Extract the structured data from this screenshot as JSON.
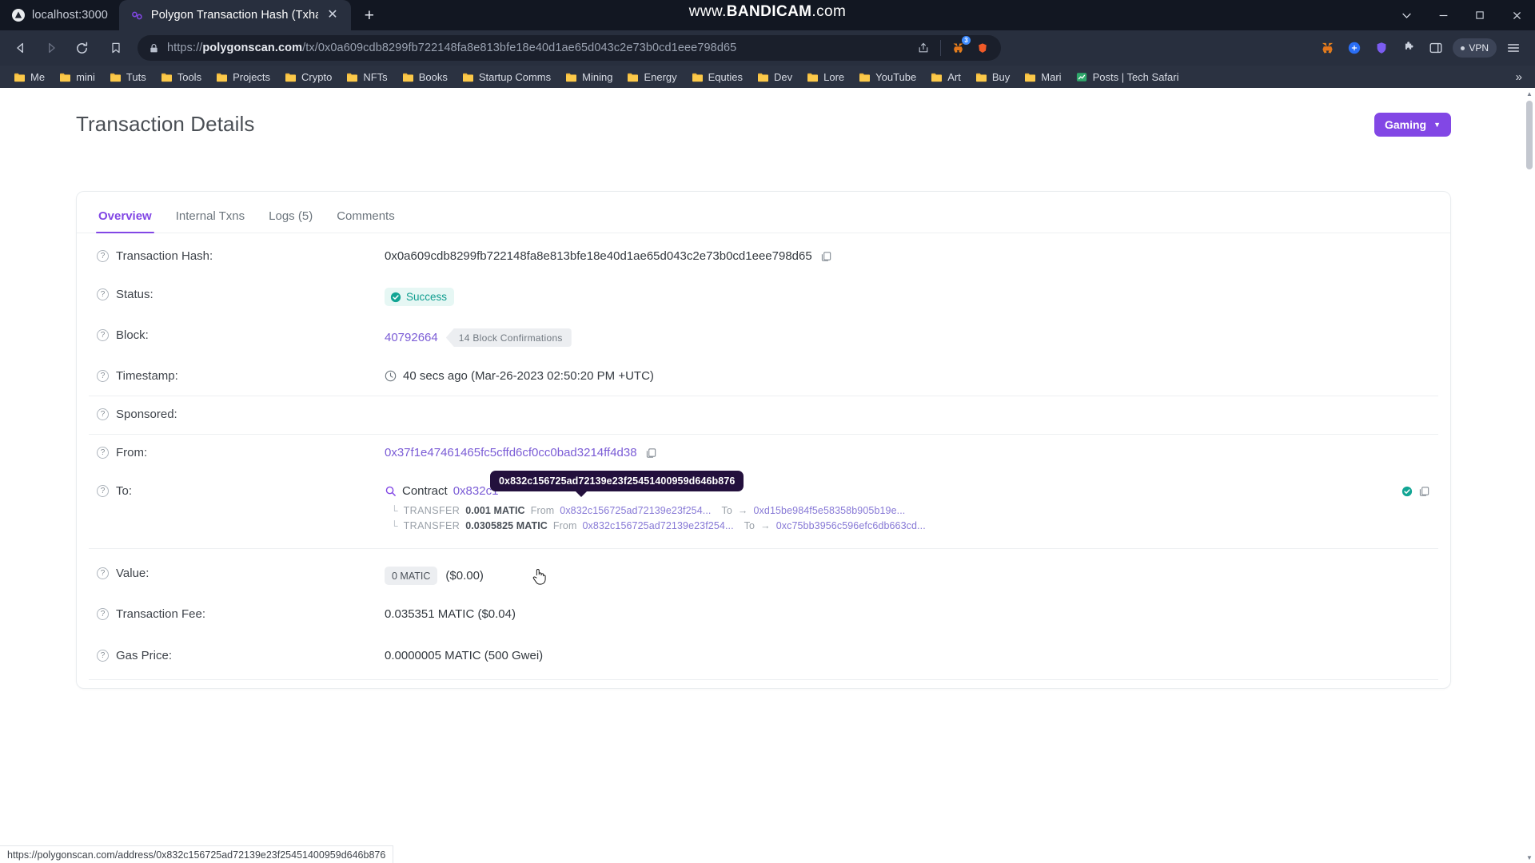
{
  "browser": {
    "tabs": [
      {
        "title": "localhost:3000",
        "favicon": "triangle-icon",
        "active": false
      },
      {
        "title": "Polygon Transaction Hash (Txhash",
        "favicon": "polygon-icon",
        "active": true
      }
    ],
    "new_tab_label": "+",
    "watermark": {
      "pre": "www.",
      "brand": "BANDICAM",
      "post": ".com"
    },
    "window_controls": {
      "expand": "∨",
      "minimize": "—",
      "maximize": "❐",
      "close": "✕"
    },
    "omnibox": {
      "url_scheme": "https://",
      "url_host": "polygonscan.com",
      "url_path": "/tx/0x0a609cdb8299fb722148fa8e813bfe18e40d1ae65d043c2e73b0cd1eee798d65",
      "full_url": "https://polygonscan.com/tx/0x0a609cdb8299fb722148fa8e813bfe18e40d1ae65d043c2e73b0cd1eee798d65",
      "lock": "lock-icon",
      "share": "share-icon",
      "metamask_badge": "3"
    },
    "vpn_label": "VPN",
    "bookmarks": [
      "Me",
      "mini",
      "Tuts",
      "Tools",
      "Projects",
      "Crypto",
      "NFTs",
      "Books",
      "Startup Comms",
      "Mining",
      "Energy",
      "Equties",
      "Dev",
      "Lore",
      "YouTube",
      "Art",
      "Buy",
      "Mari"
    ],
    "bookmark_last": "Posts | Tech Safari",
    "bookmark_overflow": "»",
    "status_link": "https://polygonscan.com/address/0x832c156725ad72139e23f25451400959d646b876"
  },
  "page": {
    "title": "Transaction Details",
    "gaming_button": "Gaming",
    "tabs": [
      {
        "label": "Overview",
        "active": true
      },
      {
        "label": "Internal Txns",
        "active": false
      },
      {
        "label": "Logs (5)",
        "active": false
      },
      {
        "label": "Comments",
        "active": false
      }
    ],
    "rows": {
      "tx_hash": {
        "label": "Transaction Hash:",
        "value": "0x0a609cdb8299fb722148fa8e813bfe18e40d1ae65d043c2e73b0cd1eee798d65"
      },
      "status": {
        "label": "Status:",
        "value": "Success"
      },
      "block": {
        "label": "Block:",
        "number": "40792664",
        "confirmations": "14 Block Confirmations"
      },
      "timestamp": {
        "label": "Timestamp:",
        "value": "40 secs ago (Mar-26-2023 02:50:20 PM +UTC)"
      },
      "sponsored": {
        "label": "Sponsored:",
        "value": ""
      },
      "from": {
        "label": "From:",
        "value": "0x37f1e47461465fc5cffd6cf0cc0bad3214ff4d38"
      },
      "to": {
        "label": "To:",
        "contract_word": "Contract",
        "address_visible": "0x832c1",
        "tooltip": "0x832c156725ad72139e23f25451400959d646b876",
        "transfers": [
          {
            "corner": "└",
            "keyword": "TRANSFER",
            "amount": "0.001 MATIC",
            "from_label": "From",
            "from": "0x832c156725ad72139e23f254...",
            "to_label": "To",
            "arrow": "→",
            "to": "0xd15be984f5e58358b905b19e..."
          },
          {
            "corner": "└",
            "keyword": "TRANSFER",
            "amount": "0.0305825 MATIC",
            "from_label": "From",
            "from": "0x832c156725ad72139e23f254...",
            "to_label": "To",
            "arrow": "→",
            "to": "0xc75bb3956c596efc6db663cd..."
          }
        ]
      },
      "value": {
        "label": "Value:",
        "amount": "0 MATIC",
        "usd": "($0.00)"
      },
      "tx_fee": {
        "label": "Transaction Fee:",
        "value": "0.035351 MATIC ($0.04)"
      },
      "gas_price": {
        "label": "Gas Price:",
        "value": "0.0000005 MATIC (500 Gwei)"
      }
    }
  },
  "colors": {
    "accent_purple": "#8247e5",
    "success_green": "#0f9d8f",
    "link_purple": "#7b5cd6",
    "tooltip_bg": "#23103d"
  }
}
